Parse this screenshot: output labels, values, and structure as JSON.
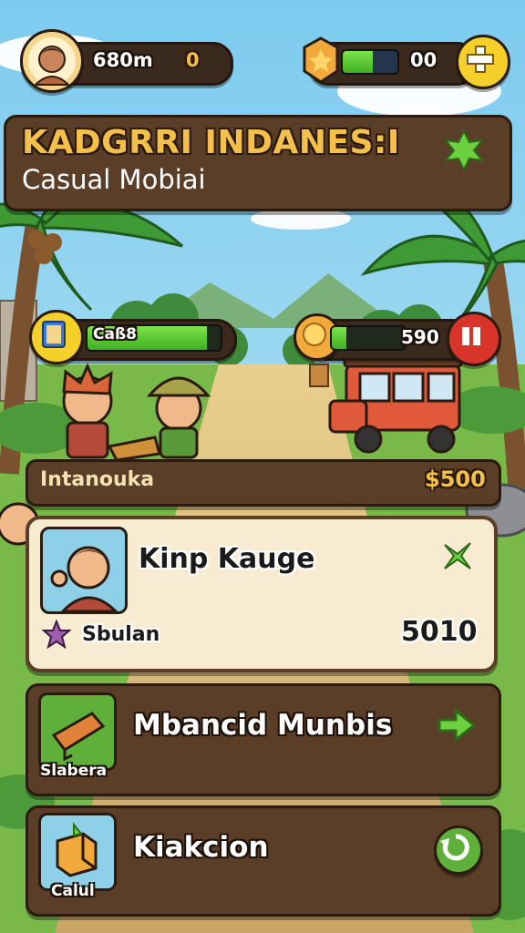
{
  "hud": {
    "player_value": "680m",
    "player_count": "0",
    "energy_value": "00",
    "energy_fill_pct": 0.55
  },
  "banner": {
    "title": "KADGRRI INDANES:I",
    "subtitle": "Casual Mobiai"
  },
  "scene_bars": {
    "left_label": "Caß8",
    "left_fill_pct": 0.9,
    "right_value": "590",
    "right_fill_pct": 0.2
  },
  "strip": {
    "label": "Intanouka",
    "value": "$500"
  },
  "cards": [
    {
      "title": "Kinp Kauge",
      "sublabel": "Sbulan",
      "value": "5010"
    },
    {
      "title": "Mbancid Munbis",
      "icon_label": "Slabera"
    },
    {
      "title": "Kiakcion",
      "icon_label": "Calul"
    }
  ],
  "colors": {
    "sky": "#8fd3f0",
    "panel_brown": "#5b3e27",
    "panel_light": "#f7ecd1",
    "accent_green": "#5fd13a",
    "accent_gold": "#f5c04a",
    "accent_red": "#d8342a"
  }
}
